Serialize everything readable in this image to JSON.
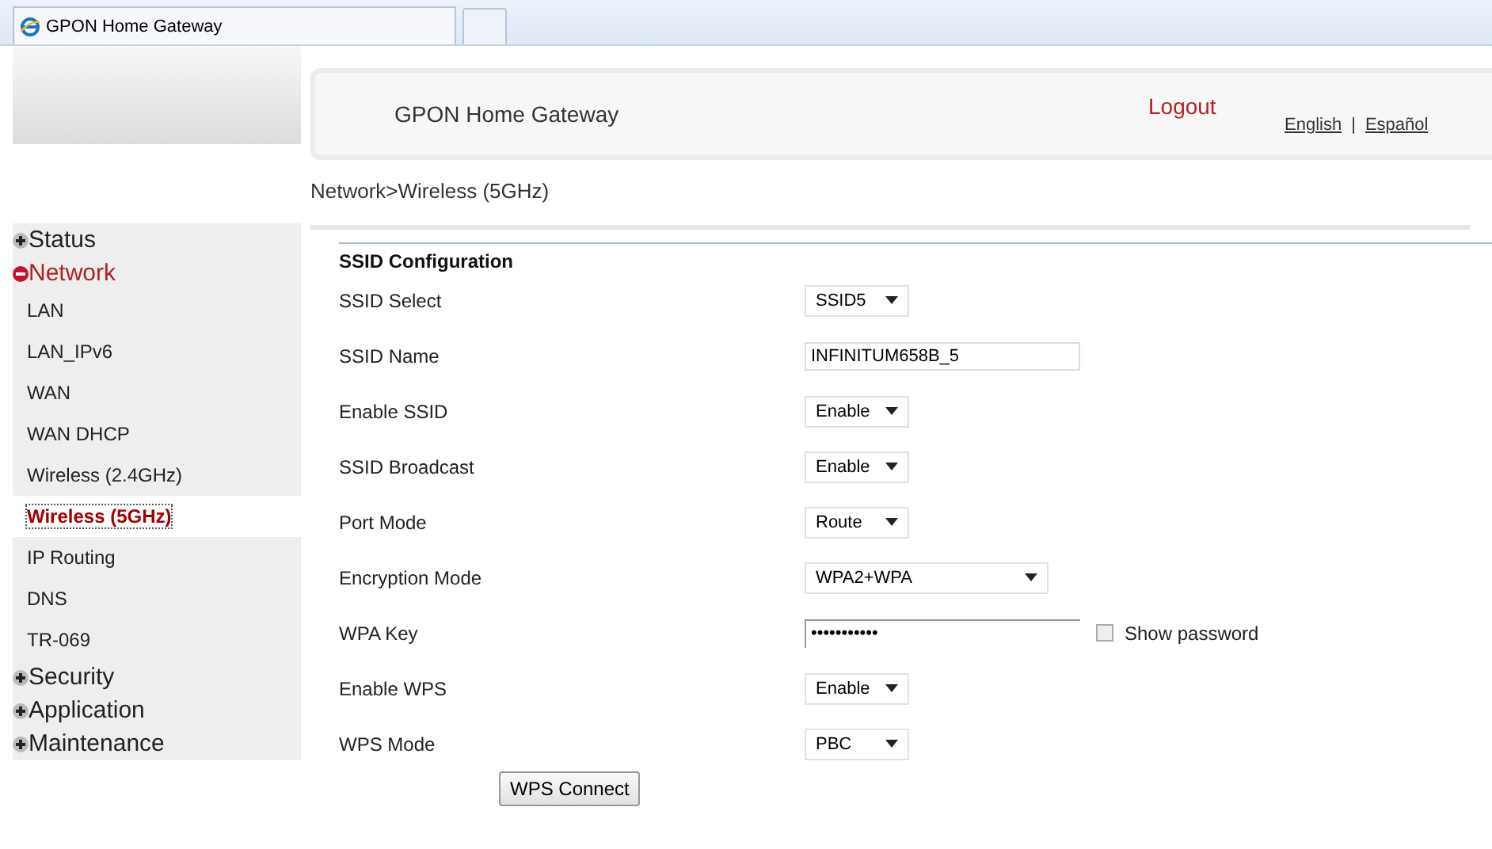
{
  "browser_tab": {
    "title": "GPON Home Gateway"
  },
  "header": {
    "title": "GPON Home Gateway",
    "logout": "Logout",
    "languages": [
      {
        "label": "English"
      },
      {
        "label": "Español"
      }
    ],
    "separator": "|"
  },
  "breadcrumb": "Network>Wireless (5GHz)",
  "sidebar": {
    "items": [
      {
        "label": "Status",
        "expanded": false
      },
      {
        "label": "Network",
        "expanded": true,
        "children": [
          {
            "label": "LAN",
            "selected": false
          },
          {
            "label": "LAN_IPv6",
            "selected": false
          },
          {
            "label": "WAN",
            "selected": false
          },
          {
            "label": "WAN DHCP",
            "selected": false
          },
          {
            "label": "Wireless (2.4GHz)",
            "selected": false
          },
          {
            "label": "Wireless (5GHz)",
            "selected": true
          },
          {
            "label": "IP Routing",
            "selected": false
          },
          {
            "label": "DNS",
            "selected": false
          },
          {
            "label": "TR-069",
            "selected": false
          }
        ]
      },
      {
        "label": "Security",
        "expanded": false
      },
      {
        "label": "Application",
        "expanded": false
      },
      {
        "label": "Maintenance",
        "expanded": false
      }
    ]
  },
  "section_title": "SSID Configuration",
  "fields": [
    {
      "label": "SSID Select",
      "kind": "select",
      "value": "SSID5"
    },
    {
      "label": "SSID Name",
      "kind": "text",
      "value": "INFINITUM658B_5"
    },
    {
      "label": "Enable SSID",
      "kind": "select",
      "value": "Enable"
    },
    {
      "label": "SSID Broadcast",
      "kind": "select",
      "value": "Enable"
    },
    {
      "label": "Port Mode",
      "kind": "select",
      "value": "Route"
    },
    {
      "label": "Encryption Mode",
      "kind": "wide_select",
      "value": "WPA2+WPA"
    },
    {
      "label": "WPA Key",
      "kind": "password",
      "value": "•••••••••••",
      "show_password": {
        "label": "Show password",
        "checked": false
      }
    },
    {
      "label": "Enable WPS",
      "kind": "select",
      "value": "Enable"
    },
    {
      "label": "WPS Mode",
      "kind": "select",
      "value": "PBC"
    }
  ],
  "wps_button": "WPS Connect"
}
